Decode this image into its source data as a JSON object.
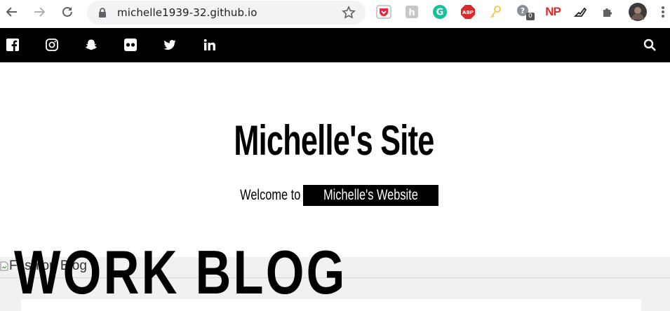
{
  "browser": {
    "url": "michelle1939-32.github.io",
    "extension_badge_count": "0",
    "extension_np_label": "NP",
    "extension_abp_label": "ABP"
  },
  "social_nav": {
    "items": [
      "facebook",
      "instagram",
      "snapchat",
      "flickr",
      "twitter",
      "linkedin"
    ]
  },
  "header": {
    "site_title": "Michelle's Site",
    "welcome_prefix": "Welcome to",
    "welcome_highlight": "Michelle's Website"
  },
  "blog": {
    "heading": "WORK BLOG",
    "image_alt": "Fashion Blog"
  },
  "colors": {
    "nav_bg": "#000000",
    "section_bg": "#f1f1f1",
    "accent_green": "#1fb4a0",
    "accent_red": "#d92b2b"
  }
}
